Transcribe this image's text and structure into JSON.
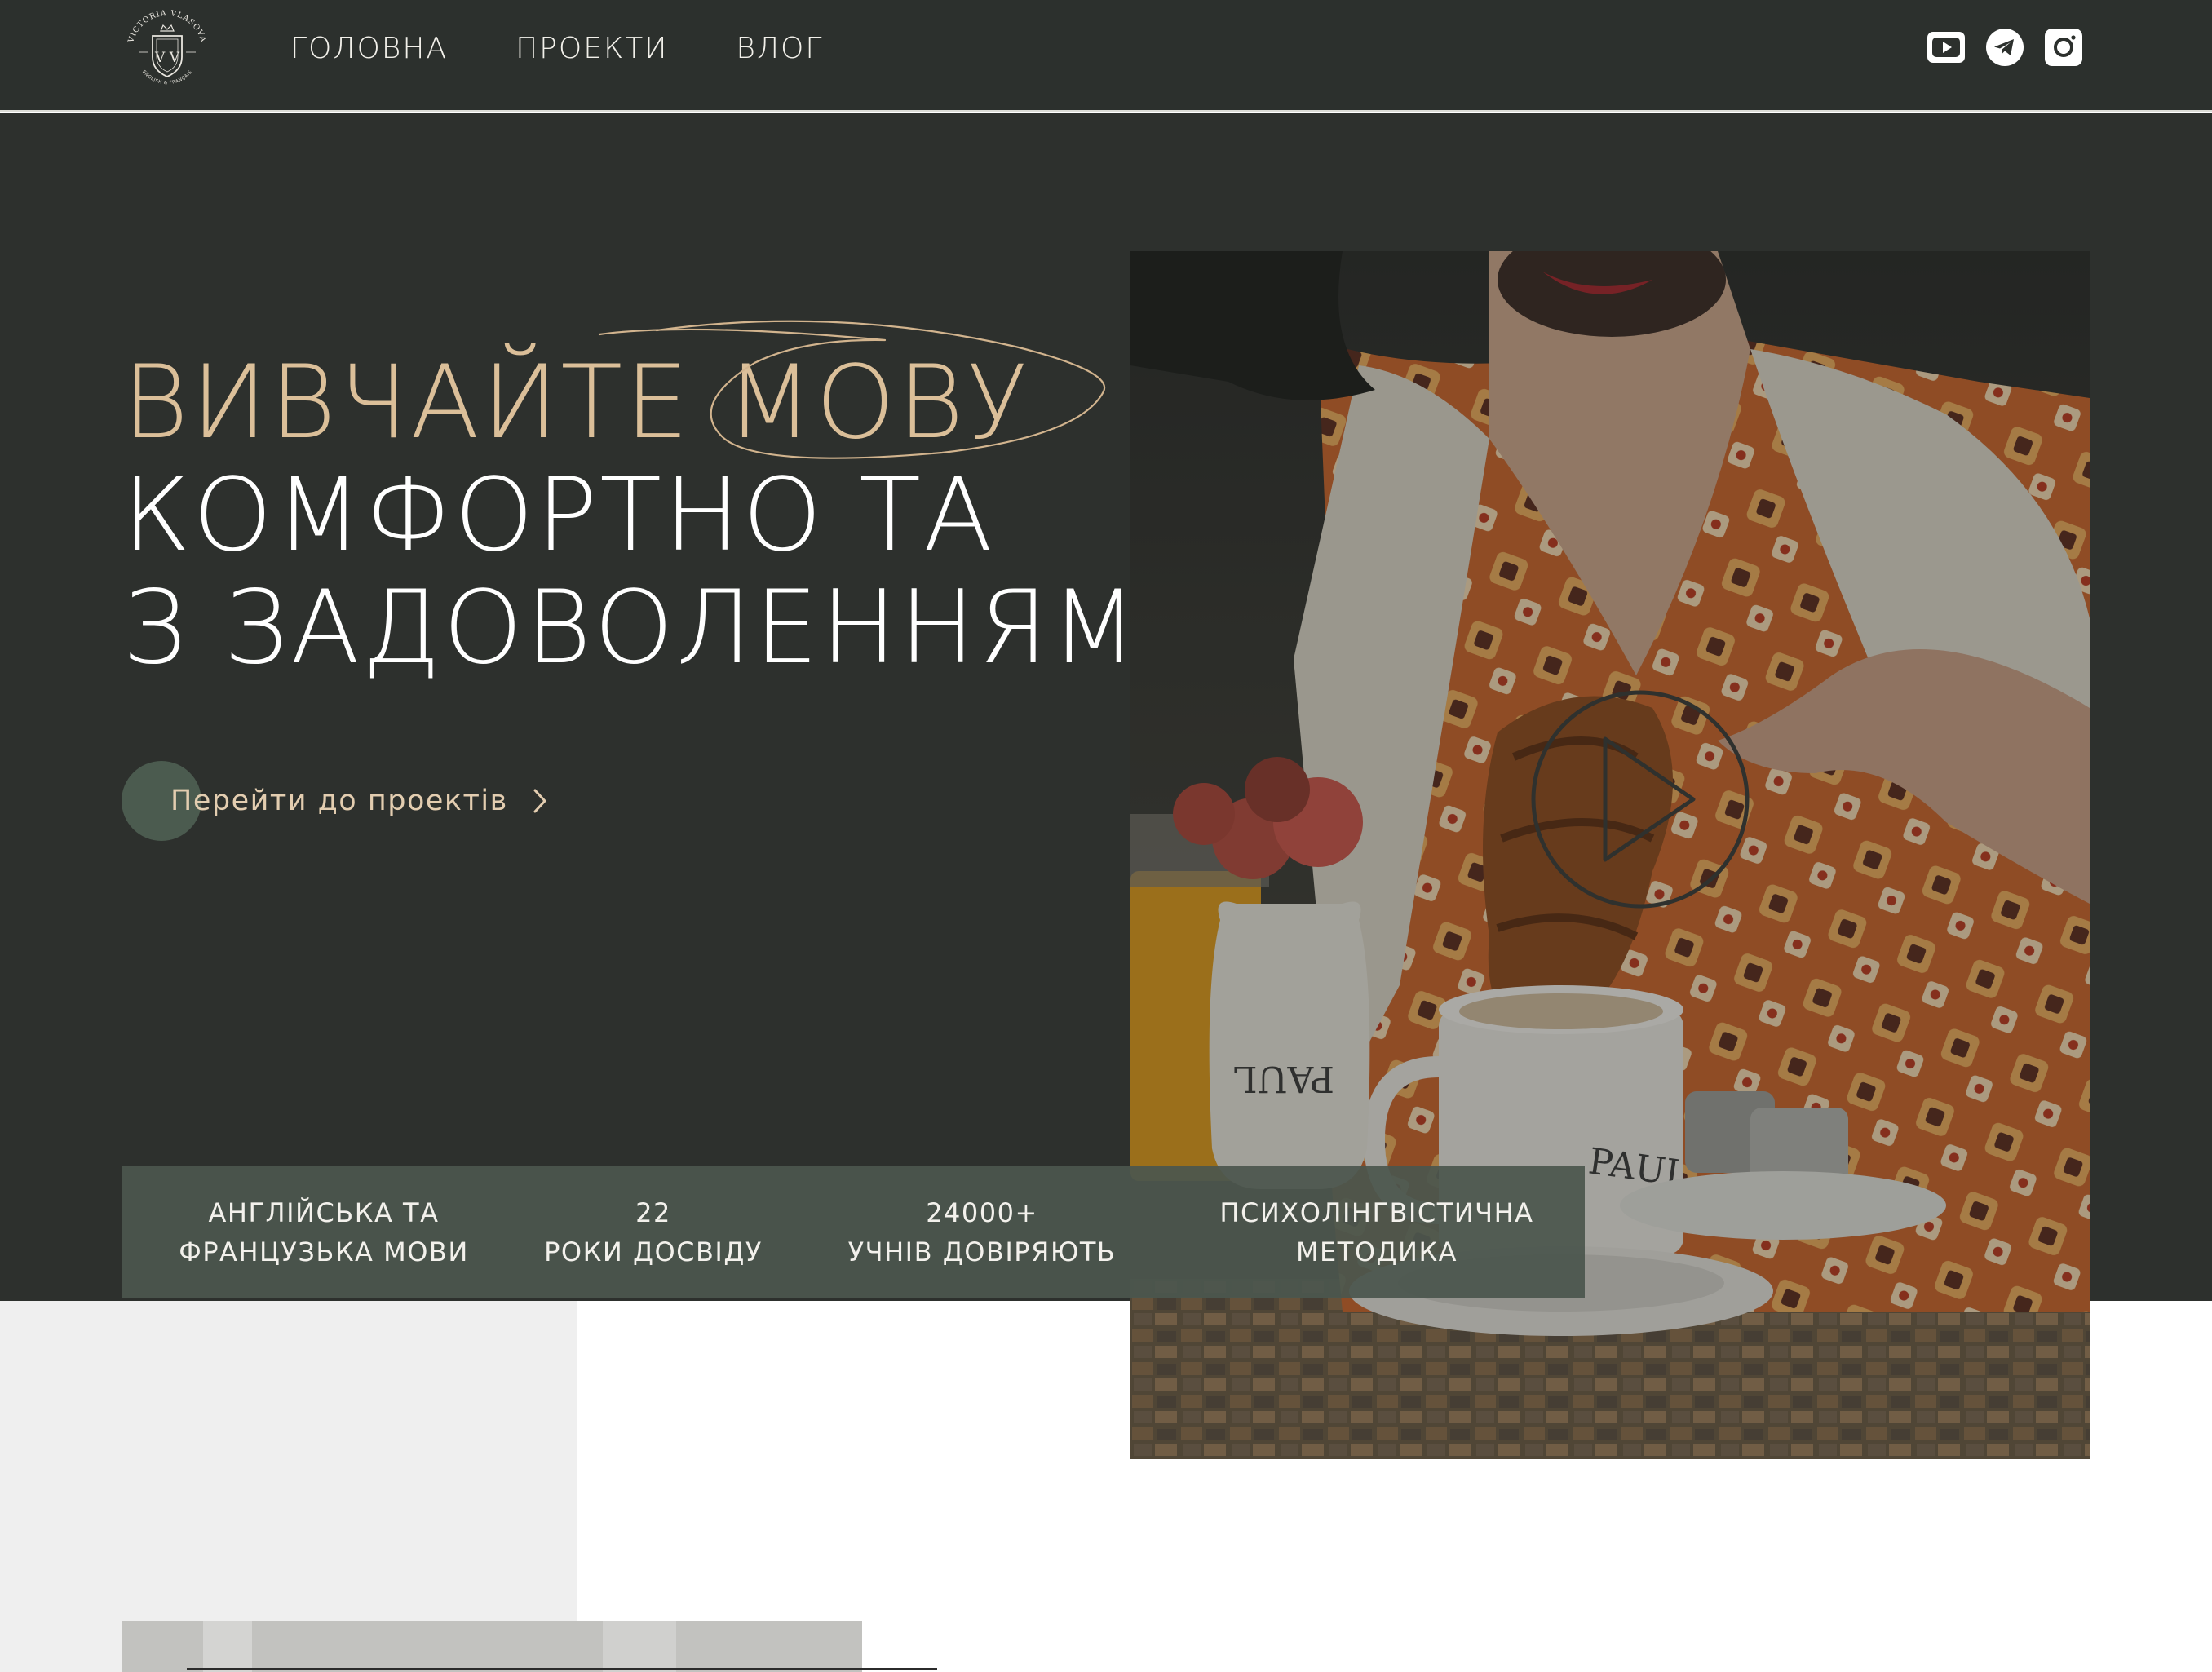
{
  "brand": {
    "logo_name": "VICTORIA VLASOVA",
    "logo_sub": "ENGLISH & FRANÇAIS",
    "logo_monogram": "V V"
  },
  "nav": {
    "items": [
      {
        "label": "ГОЛОВНА"
      },
      {
        "label": "ПРОЕКТИ"
      },
      {
        "label": "ВЛОГ"
      }
    ]
  },
  "social": {
    "items": [
      {
        "icon": "youtube-icon"
      },
      {
        "icon": "telegram-icon"
      },
      {
        "icon": "instagram-icon"
      }
    ]
  },
  "hero": {
    "headline": {
      "line1": "ВИВЧАЙТЕ МОВУ",
      "line2": "КОМФОРТНО ТА",
      "line3": "З ЗАДОВОЛЕННЯМ"
    },
    "cta_label": "Перейти до проектів",
    "photo_texts": {
      "vase_brand": "PAUL",
      "cup_brand": "PAUL"
    }
  },
  "stats": [
    {
      "line1": "АНГЛІЙСЬКА ТА",
      "line2": "ФРАНЦУЗЬКА МОВИ"
    },
    {
      "line1": "22",
      "line2": "РОКИ ДОСВІДУ"
    },
    {
      "line1": "24000+",
      "line2": "УЧНІВ ДОВІРЯЮТЬ"
    },
    {
      "line1": "ПСИХОЛІНГВІСТИЧНА",
      "line2": "МЕТОДИКА"
    }
  ],
  "colors": {
    "header_bg": "#2c302d",
    "hero_bg": "#2d302d",
    "accent_gold": "#dbbf99",
    "stats_bg": "#4b564e",
    "cta_circle": "#4b5b4f"
  }
}
